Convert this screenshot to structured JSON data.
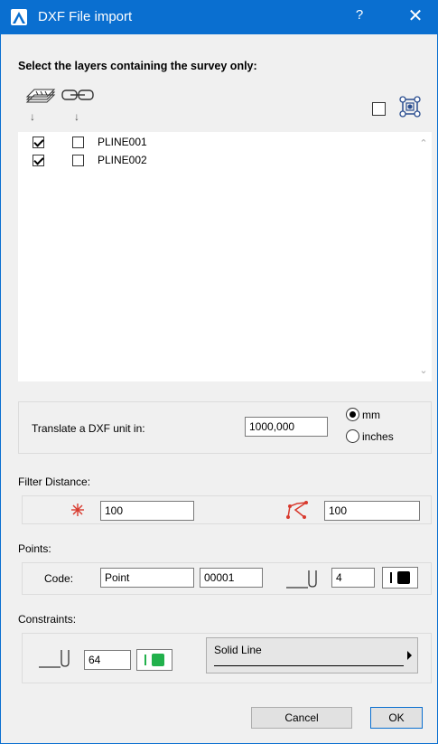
{
  "window": {
    "title": "DXF File import",
    "help": "?",
    "close": "✕"
  },
  "heading": "Select the layers containing the survey only:",
  "layers": [
    {
      "name": "PLINE001",
      "survey": true,
      "linked": false
    },
    {
      "name": "PLINE002",
      "survey": true,
      "linked": false
    }
  ],
  "select_all_checked": false,
  "translate": {
    "label": "Translate a DXF unit in:",
    "value": "1000,000",
    "unit_mm": "mm",
    "unit_inches": "inches",
    "selected": "mm"
  },
  "filter": {
    "label": "Filter Distance:",
    "value1": "100",
    "value2": "100"
  },
  "points": {
    "label": "Points:",
    "code_label": "Code:",
    "code_value": "Point",
    "code_number": "00001",
    "pen_value": "4",
    "pen_color": "#000000"
  },
  "constraints": {
    "label": "Constraints:",
    "pen_value": "64",
    "pen_color": "#22b14c",
    "line_type": "Solid Line"
  },
  "buttons": {
    "cancel": "Cancel",
    "ok": "OK"
  },
  "arrow_glyph": "↓",
  "colors": {
    "titlebar": "#0a6fd0",
    "marker": "#d83a2e"
  }
}
